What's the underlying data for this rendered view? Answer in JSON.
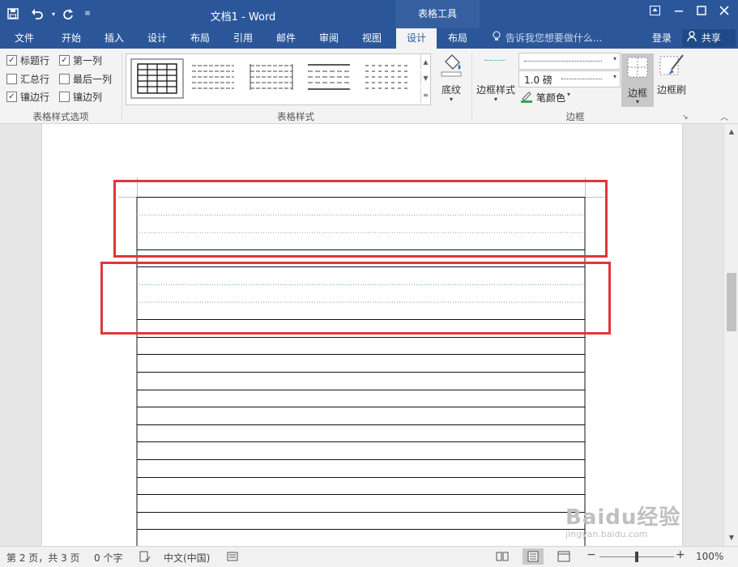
{
  "window": {
    "title": "文档1 - Word",
    "context_tab_header": "表格工具",
    "buttons": [
      "ribbon-display-icon",
      "minimize-icon",
      "maximize-icon",
      "close-icon"
    ]
  },
  "quick_access": [
    "save-icon",
    "undo-icon",
    "redo-icon",
    "customize-icon"
  ],
  "tabs": [
    {
      "label": "文件",
      "active": false
    },
    {
      "label": "开始",
      "active": false
    },
    {
      "label": "插入",
      "active": false
    },
    {
      "label": "设计",
      "active": false
    },
    {
      "label": "布局",
      "active": false
    },
    {
      "label": "引用",
      "active": false
    },
    {
      "label": "邮件",
      "active": false
    },
    {
      "label": "审阅",
      "active": false
    },
    {
      "label": "视图",
      "active": false
    },
    {
      "label": "设计",
      "active": true
    },
    {
      "label": "布局",
      "active": false
    }
  ],
  "tell_me": "告诉我您想要做什么...",
  "sign_in": "登录",
  "share": "共享",
  "ribbon": {
    "style_options": {
      "group_label": "表格样式选项",
      "checkboxes": [
        {
          "label": "标题行",
          "checked": true
        },
        {
          "label": "第一列",
          "checked": true
        },
        {
          "label": "汇总行",
          "checked": false
        },
        {
          "label": "最后一列",
          "checked": false
        },
        {
          "label": "镶边行",
          "checked": true
        },
        {
          "label": "镶边列",
          "checked": false
        }
      ]
    },
    "table_styles": {
      "group_label": "表格样式",
      "shading_label": "底纹"
    },
    "borders": {
      "group_label": "边框",
      "border_styles_label": "边框样式",
      "pen_weight": "1.0 磅",
      "pen_color_label": "笔颜色",
      "borders_label": "边框",
      "border_painter_label": "边框刷"
    }
  },
  "document": {
    "table_row_count": 20,
    "dotted_rows": [
      1,
      5
    ],
    "highlight_color": "#e0363a"
  },
  "status": {
    "page": "第 2 页，共 3 页",
    "words": "0 个字",
    "language": "中文(中国)",
    "zoom": "100%",
    "zoom_fraction": 0.5
  },
  "watermark": "Baidu经验",
  "watermark_sub": "jingyan.baidu.com",
  "colors": {
    "brand": "#2b579a",
    "ribbon": "#f3f3f3",
    "highlight": "#e0363a"
  }
}
